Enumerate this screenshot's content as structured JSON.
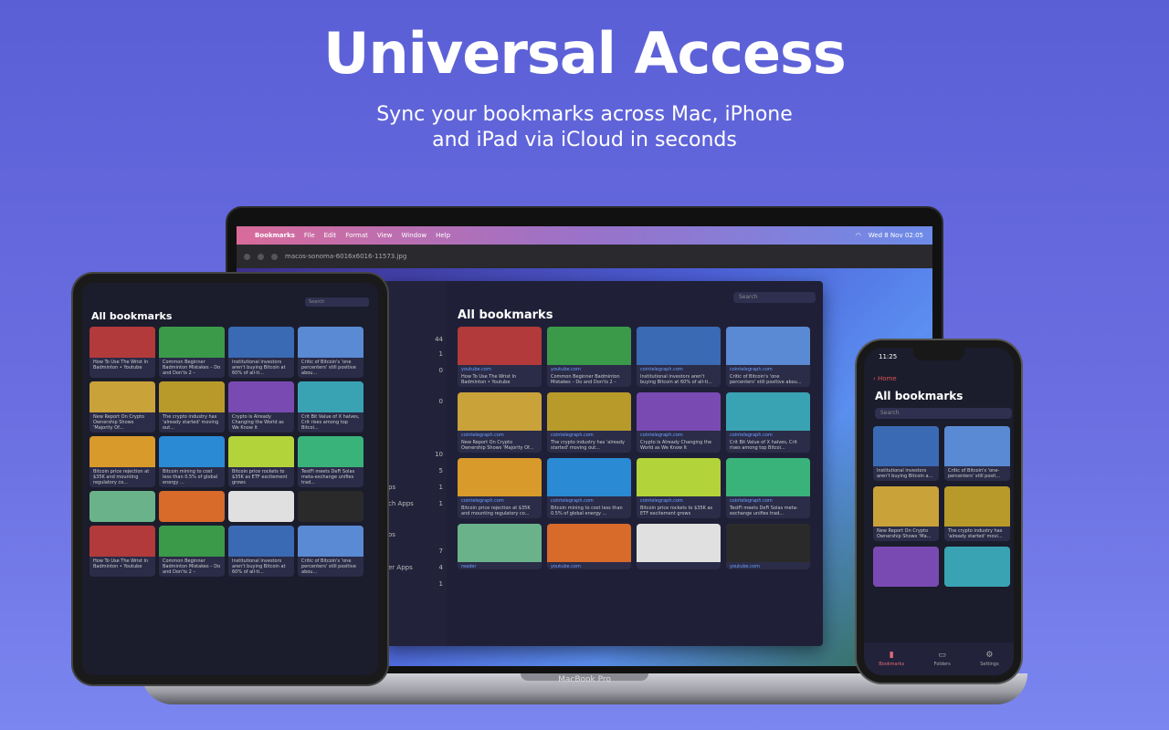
{
  "hero": {
    "title": "Universal Access",
    "subtitle_line1": "Sync your bookmarks across Mac, iPhone",
    "subtitle_line2": "and iPad via iCloud in seconds"
  },
  "mac": {
    "label": "MacBook Pro",
    "menubar": {
      "app": "Bookmarks",
      "items": [
        "File",
        "Edit",
        "Format",
        "View",
        "Window",
        "Help"
      ],
      "clock": "Wed 8 Nov  02:05"
    },
    "preview_file": "macos-sonoma-6016x6016-11573.jpg",
    "app": {
      "title": "All bookmarks",
      "search_placeholder": "Search",
      "sidebar_counts": [
        "44",
        "1",
        "0",
        "0",
        "10",
        "5",
        "1",
        "1",
        "7",
        "4",
        "1"
      ],
      "sidebar_labels": [
        "ps",
        "ch Apps",
        "os",
        "er Apps"
      ],
      "cards": [
        {
          "site": "youtube.com",
          "title": "How To Use The Wrist In Badminton • Youtube",
          "color": "#b33a3a"
        },
        {
          "site": "youtube.com",
          "title": "Common Beginner Badminton Mistakes – Do and Don'ts 2 –",
          "color": "#3a9a4a"
        },
        {
          "site": "cointelegraph.com",
          "title": "Institutional investors aren't buying Bitcoin at 60% of all-ti...",
          "color": "#3a6ab3"
        },
        {
          "site": "cointelegraph.com",
          "title": "Critic of Bitcoin's 'one percenters' still positive abou...",
          "color": "#5a8ad3"
        },
        {
          "site": "cointelegraph.com",
          "title": "New Report On Crypto Ownership Shows 'Majority Of...",
          "color": "#c9a23a"
        },
        {
          "site": "cointelegraph.com",
          "title": "The crypto industry has 'already started' moving out...",
          "color": "#b89a2a"
        },
        {
          "site": "cointelegraph.com",
          "title": "Crypto is Already Changing the World as We Know It",
          "color": "#7a4ab3"
        },
        {
          "site": "cointelegraph.com",
          "title": "Crit Bit Value of X halves, Crit rises among top Bitcoi...",
          "color": "#3aa3b3"
        },
        {
          "site": "cointelegraph.com",
          "title": "Bitcoin price rejection at $35K and mounting regulatory co...",
          "color": "#d89a2a"
        },
        {
          "site": "cointelegraph.com",
          "title": "Bitcoin mining to cost less than 0.5% of global energy ...",
          "color": "#2a8ad3"
        },
        {
          "site": "cointelegraph.com",
          "title": "Bitcoin price rockets to $35K as ETF excitement grows",
          "color": "#b3d33a"
        },
        {
          "site": "cointelegraph.com",
          "title": "TestFi meets DeFi Solas meta-exchange unifies trad...",
          "color": "#3ab37a"
        },
        {
          "site": "reader",
          "title": "",
          "color": "#6ab38a"
        },
        {
          "site": "youtube.com",
          "title": "",
          "color": "#d86a2a"
        },
        {
          "site": "",
          "title": "",
          "color": "#e0e0e0"
        },
        {
          "site": "youtube.com",
          "title": "",
          "color": "#2a2a2a"
        }
      ]
    }
  },
  "ipad": {
    "title": "All bookmarks",
    "search_placeholder": "Search"
  },
  "iphone": {
    "time": "11:25",
    "back_label": "Home",
    "title": "All bookmarks",
    "search_placeholder": "Search",
    "cards": [
      {
        "title": "Institutional investors aren't buying Bitcoin a...",
        "color": "#3a6ab3"
      },
      {
        "title": "Critic of Bitcoin's 'one-percenters' still posit...",
        "color": "#5a8ad3"
      },
      {
        "title": "New Report On Crypto Ownership Shows 'Ma...",
        "color": "#c9a23a"
      },
      {
        "title": "The crypto industry has 'already started' movi...",
        "color": "#b89a2a"
      },
      {
        "title": "",
        "color": "#7a4ab3"
      },
      {
        "title": "",
        "color": "#3aa3b3"
      }
    ],
    "tabs": [
      "Bookmarks",
      "Folders",
      "Settings"
    ]
  }
}
